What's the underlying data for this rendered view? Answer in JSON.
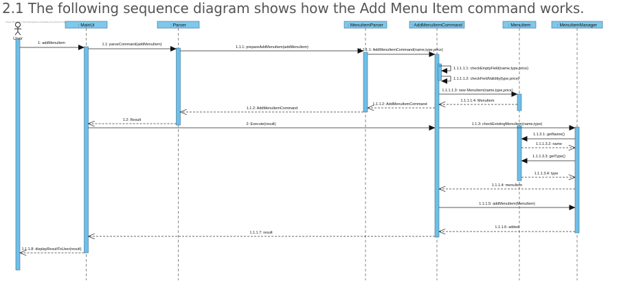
{
  "page": {
    "heading": "2.1 The following sequence diagram shows how the Add Menu Item command works.",
    "watermark": "Visual Paradigm Standard(Joshua Koa(Nanyang Technological Univ"
  },
  "colors": {
    "lifeline_box": "#7ec8ec",
    "lifeline_box_border": "#3a6f8c",
    "activation": "#6ebfe8",
    "line": "#222222",
    "lifeline_dash": "#555555"
  },
  "diagram": {
    "actor": {
      "label": "User"
    },
    "lifelines": [
      {
        "id": "mainui",
        "label": ": MainUi"
      },
      {
        "id": "parser",
        "label": ": Parser"
      },
      {
        "id": "menuitemparser",
        "label": ": MenuItemParser"
      },
      {
        "id": "addmenuitemcommand",
        "label": ": AddMenuItemCommand"
      },
      {
        "id": "menuitem",
        "label": ": MenuItem"
      },
      {
        "id": "menuitemmanager",
        "label": ": MenuItemManager"
      }
    ],
    "messages": [
      {
        "label": "1: addMenuItem",
        "from": "user",
        "to": "mainui",
        "kind": "sync"
      },
      {
        "label": "1.1: parseCommand(addMenuItem)",
        "from": "mainui",
        "to": "parser",
        "kind": "sync"
      },
      {
        "label": "1.1.1: prepareAddMenuItem(addMenuItem)",
        "from": "parser",
        "to": "menuitemparser",
        "kind": "sync"
      },
      {
        "label": "1.1.1.1: AddMenuItemCommand(name,type,price)",
        "from": "menuitemparser",
        "to": "addmenuitemcommand",
        "kind": "sync"
      },
      {
        "label": "1.1.1.1.1: checkEmptyField(name,type,price)",
        "from": "addmenuitemcommand",
        "to": "addmenuitemcommand",
        "kind": "self"
      },
      {
        "label": "1.1.1.1.2: checkFieldValidity(type,price)",
        "from": "addmenuitemcommand",
        "to": "addmenuitemcommand",
        "kind": "self"
      },
      {
        "label": "1.1.1.1.3: new MenuItem(name,type,price)",
        "from": "addmenuitemcommand",
        "to": "menuitem",
        "kind": "sync"
      },
      {
        "label": "1.1.1.1.4: MenuItem",
        "from": "menuitem",
        "to": "addmenuitemcommand",
        "kind": "return"
      },
      {
        "label": "1.1.1.2: AddMenuItemCommand",
        "from": "addmenuitemcommand",
        "to": "menuitemparser",
        "kind": "return"
      },
      {
        "label": "1.1.2: AddMenuItemCommand",
        "from": "menuitemparser",
        "to": "parser",
        "kind": "return"
      },
      {
        "label": "1.2: Result",
        "from": "parser",
        "to": "mainui",
        "kind": "return"
      },
      {
        "label": "2: Execute(result)",
        "from": "mainui",
        "to": "addmenuitemcommand",
        "kind": "sync"
      },
      {
        "label": "1.1.3: checkExistingMenuItem(name,type)",
        "from": "addmenuitemcommand",
        "to": "menuitemmanager",
        "kind": "sync"
      },
      {
        "label": "1.1.3.1: getName()",
        "from": "menuitemmanager",
        "to": "menuitem",
        "kind": "sync"
      },
      {
        "label": "1.1.1.3.2: name",
        "from": "menuitem",
        "to": "menuitemmanager",
        "kind": "return"
      },
      {
        "label": "1.1.1.3.3: getType()",
        "from": "menuitemmanager",
        "to": "menuitem",
        "kind": "sync"
      },
      {
        "label": "1.1.1.3.4: type",
        "from": "menuitem",
        "to": "menuitemmanager",
        "kind": "return"
      },
      {
        "label": "1.1.1.4: menuItem",
        "from": "menuitemmanager",
        "to": "addmenuitemcommand",
        "kind": "return"
      },
      {
        "label": "1.1.1.5: addMenuItem(MenuItem)",
        "from": "addmenuitemcommand",
        "to": "menuitemmanager",
        "kind": "sync"
      },
      {
        "label": "1.1.1.6: added",
        "from": "menuitemmanager",
        "to": "addmenuitemcommand",
        "kind": "return"
      },
      {
        "label": "1.1.1.7: result",
        "from": "addmenuitemcommand",
        "to": "mainui",
        "kind": "return"
      },
      {
        "label": "1.1.1.8: displayResultToUser(result)",
        "from": "mainui",
        "to": "user",
        "kind": "return"
      }
    ]
  }
}
